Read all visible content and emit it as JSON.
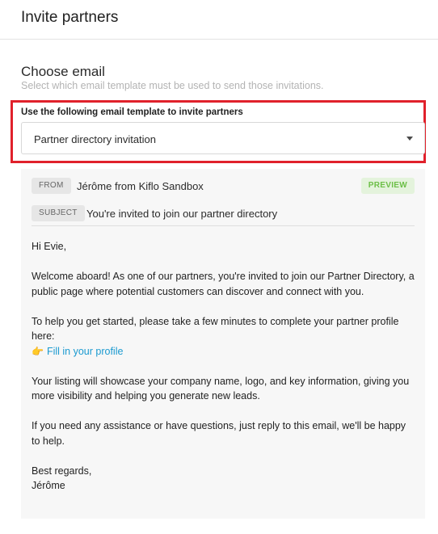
{
  "header": {
    "title": "Invite partners"
  },
  "section": {
    "title": "Choose email",
    "subtitle": "Select which email template must be used to send those invitations."
  },
  "template_field": {
    "label": "Use the following email template to invite partners",
    "selected": "Partner directory invitation",
    "highlight_color": "#e0212b"
  },
  "preview": {
    "from_tag": "FROM",
    "from_value": "Jérôme from Kiflo Sandbox",
    "badge": "PREVIEW",
    "subject_tag": "SUBJECT",
    "subject_value": "You're invited to join our partner directory",
    "body": {
      "greeting": "Hi Evie,",
      "p1": "Welcome aboard! As one of our partners, you're invited to join our Partner Directory, a public page where potential customers can discover and connect with you.",
      "p2": "To help you get started, please take a few minutes to complete your partner profile here:",
      "link_emoji": "👉",
      "link_text": "Fill in your profile",
      "p3": "Your listing will showcase your company name, logo, and key information, giving you more visibility and helping you generate new leads.",
      "p4": "If you need any assistance or have questions, just reply to this email, we'll be happy to help.",
      "closing": "Best regards,",
      "signature": "Jérôme"
    }
  },
  "colors": {
    "link": "#1b9ad0",
    "badge_green": "#6cbf47",
    "panel_bg": "#f7f7f7"
  }
}
